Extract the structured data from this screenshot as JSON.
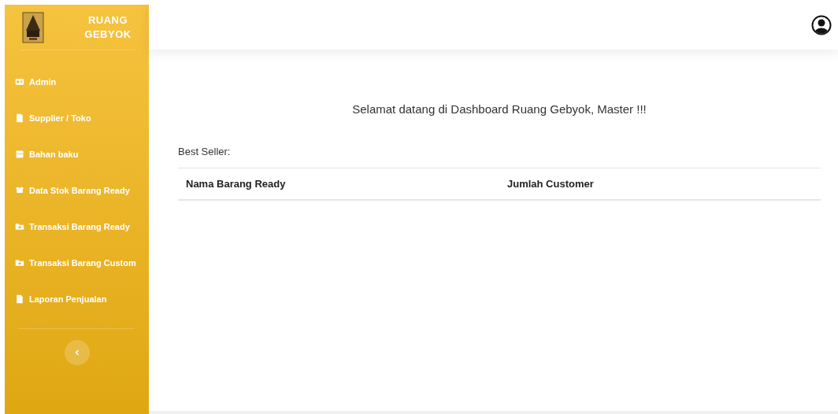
{
  "sidebar": {
    "brand": "RUANG GEBYOK",
    "items": [
      {
        "label": "Admin"
      },
      {
        "label": "Supplier / Toko"
      },
      {
        "label": "Bahan baku"
      },
      {
        "label": "Data Stok Barang Ready"
      },
      {
        "label": "Transaksi Barang Ready"
      },
      {
        "label": "Transaksi Barang Custom"
      },
      {
        "label": "Laporan Penjualan"
      }
    ]
  },
  "welcome": "Selamat datang di Dashboard Ruang Gebyok, Master !!!",
  "section_label": "Best Seller:",
  "table": {
    "columns": [
      "Nama Barang Ready",
      "Jumlah Customer"
    ]
  }
}
